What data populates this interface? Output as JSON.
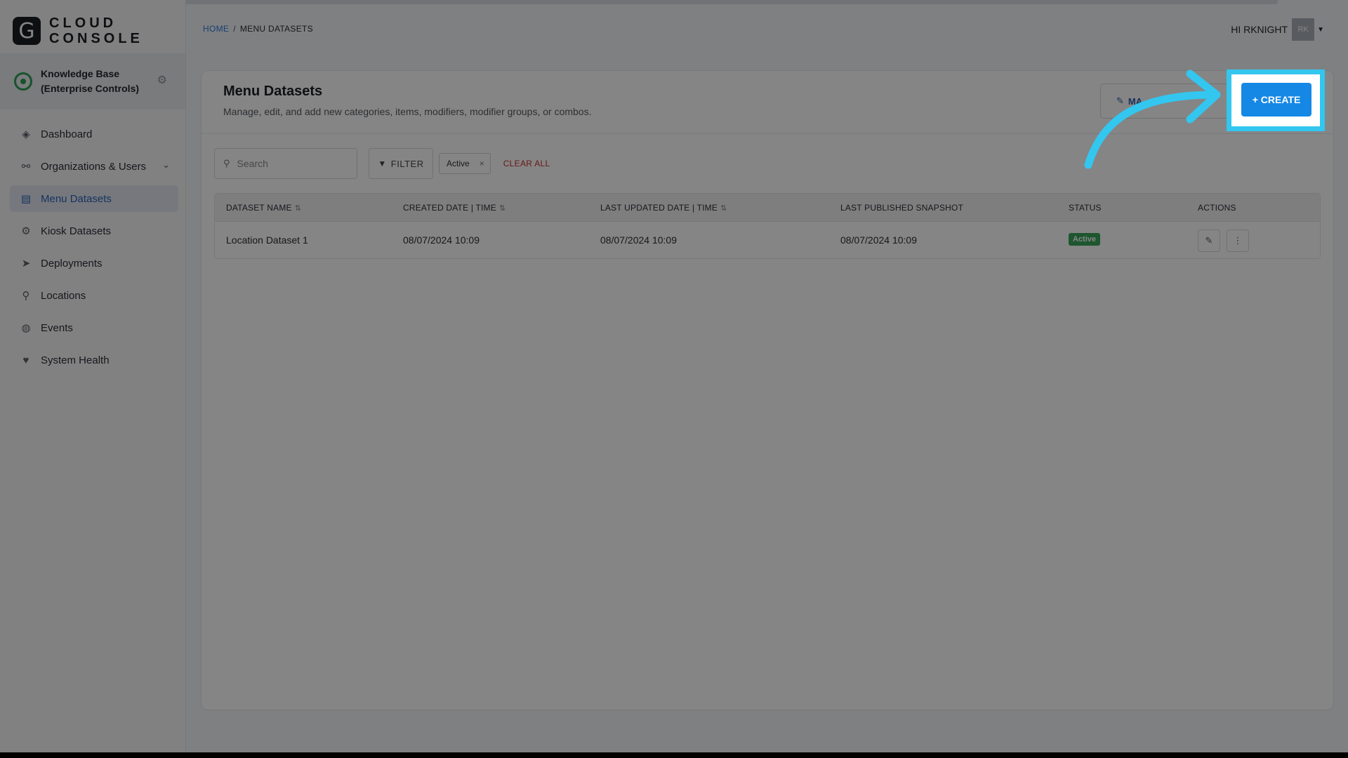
{
  "app": {
    "logo_letter": "G",
    "logo_line1": "CLOUD",
    "logo_line2": "CONSOLE",
    "org_name": "Knowledge Base (Enterprise Controls)"
  },
  "nav": {
    "items": [
      {
        "label": "Dashboard",
        "icon": "layers-icon"
      },
      {
        "label": "Organizations & Users",
        "icon": "org-chart-icon"
      },
      {
        "label": "Menu Datasets",
        "icon": "menu-dataset-icon"
      },
      {
        "label": "Kiosk Datasets",
        "icon": "gear-icon"
      },
      {
        "label": "Deployments",
        "icon": "paper-plane-icon"
      },
      {
        "label": "Locations",
        "icon": "map-pin-icon"
      },
      {
        "label": "Events",
        "icon": "globe-icon"
      },
      {
        "label": "System Health",
        "icon": "heartbeat-icon"
      }
    ]
  },
  "header": {
    "breadcrumb_home": "HOME",
    "breadcrumb_sep": "/",
    "breadcrumb_current": "MENU DATASETS",
    "greeting": "HI RKNIGHT",
    "avatar_initials": "RK"
  },
  "main": {
    "title": "Menu Datasets",
    "description": "Manage, edit, and add new categories, items, modifiers, modifier groups, or combos.",
    "manage_label": "MA",
    "create_label": "+ CREATE",
    "search_placeholder": "Search",
    "filter_label": "FILTER",
    "chip_label": "Active",
    "chip_close": "×",
    "clear_all": "CLEAR ALL",
    "columns": [
      "DATASET NAME",
      "CREATED DATE | TIME",
      "LAST UPDATED DATE | TIME",
      "LAST PUBLISHED SNAPSHOT",
      "STATUS",
      "ACTIONS"
    ],
    "rows": [
      {
        "name": "Location Dataset 1",
        "created": "08/07/2024 10:09",
        "updated": "08/07/2024 10:09",
        "published": "08/07/2024 10:09",
        "status": "Active"
      }
    ]
  },
  "colors": {
    "accent": "#1588e6",
    "highlight": "#33c6ef",
    "status_active": "#3aa55b",
    "danger": "#c9302c"
  }
}
